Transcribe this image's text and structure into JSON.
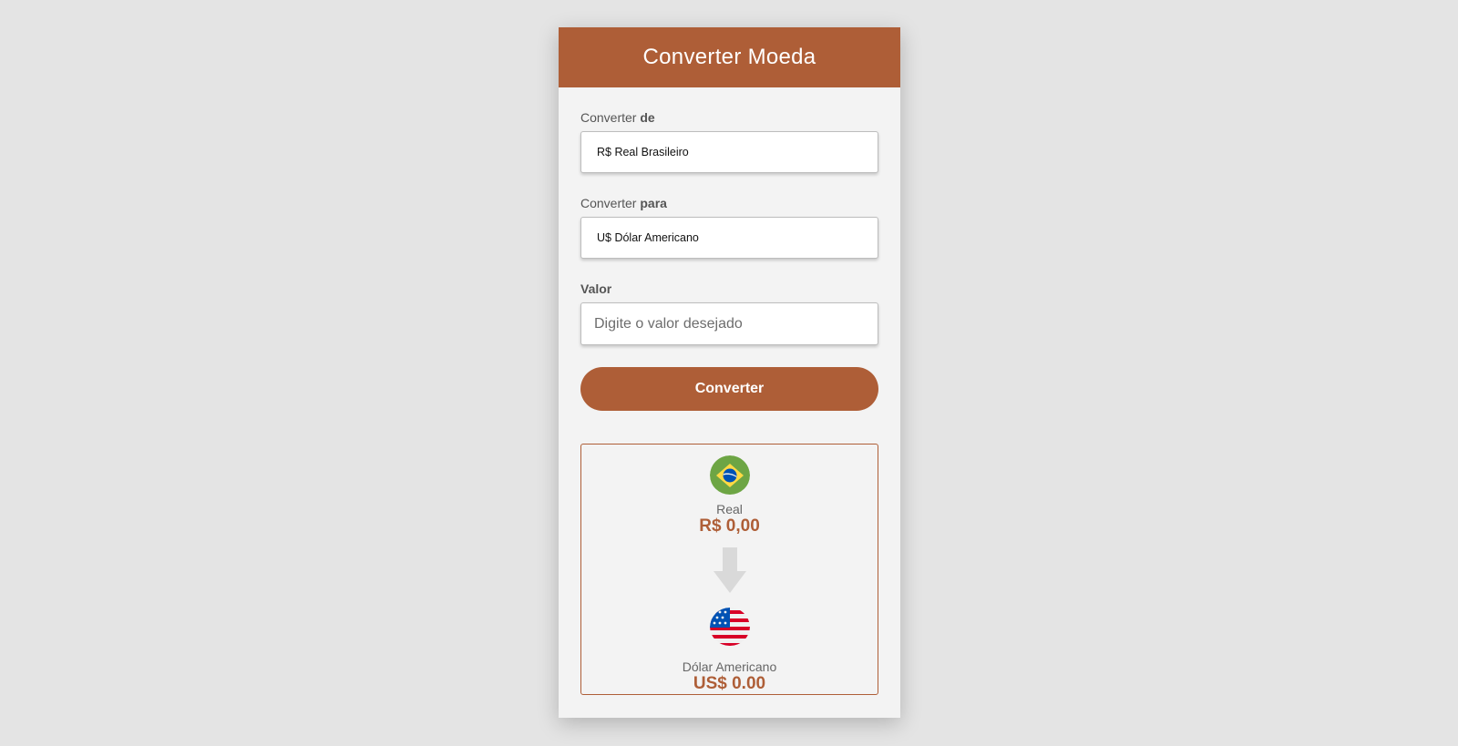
{
  "header": {
    "title": "Converter Moeda"
  },
  "form": {
    "from": {
      "label_prefix": "Converter",
      "label_bold": "de",
      "value": "R$ Real Brasileiro"
    },
    "to": {
      "label_prefix": "Converter",
      "label_bold": "para",
      "value": "U$ Dólar Americano"
    },
    "amount": {
      "label": "Valor",
      "placeholder": "Digite o valor desejado",
      "value": ""
    },
    "submit_label": "Converter"
  },
  "result": {
    "source": {
      "name": "Real",
      "value": "R$ 0,00",
      "icon": "brazil-flag-icon"
    },
    "target": {
      "name": "Dólar Americano",
      "value": "US$ 0.00",
      "icon": "usa-flag-icon"
    }
  },
  "colors": {
    "accent": "#ae5e37",
    "background": "#e4e4e4",
    "card": "#f3f3f3"
  }
}
